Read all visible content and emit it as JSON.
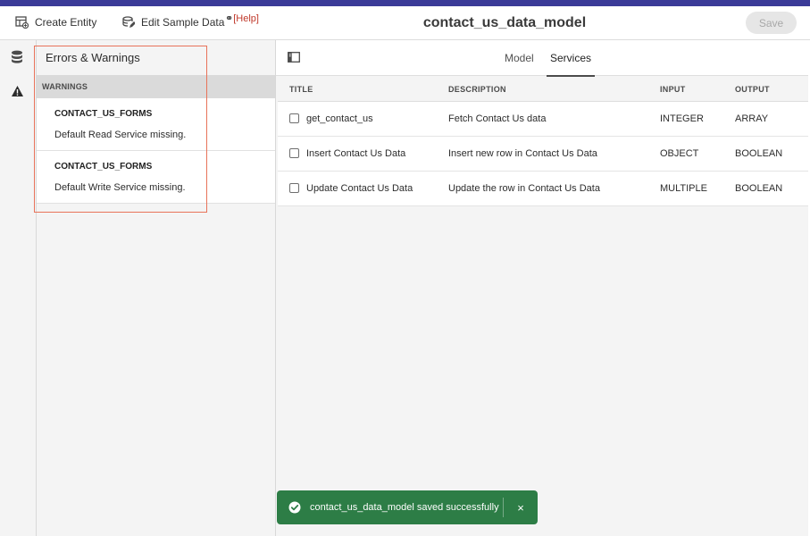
{
  "toolbar": {
    "create_entity": "Create Entity",
    "edit_sample_data": "Edit Sample Data",
    "help_link": "[Help]",
    "save": "Save"
  },
  "page_title": "contact_us_data_model",
  "errors_panel": {
    "title": "Errors & Warnings",
    "section": "WARNINGS",
    "items": [
      {
        "title": "CONTACT_US_FORMS",
        "message": "Default Read Service missing."
      },
      {
        "title": "CONTACT_US_FORMS",
        "message": "Default Write Service missing."
      }
    ]
  },
  "tabs": [
    {
      "label": "Model",
      "active": false
    },
    {
      "label": "Services",
      "active": true
    }
  ],
  "services_table": {
    "columns": [
      "TITLE",
      "DESCRIPTION",
      "INPUT",
      "OUTPUT"
    ],
    "rows": [
      {
        "title": "get_contact_us",
        "description": "Fetch Contact Us data",
        "input": "INTEGER",
        "output": "ARRAY"
      },
      {
        "title": "Insert Contact Us Data",
        "description": "Insert new row in Contact Us Data",
        "input": "OBJECT",
        "output": "BOOLEAN"
      },
      {
        "title": "Update Contact Us Data",
        "description": "Update the row in Contact Us Data",
        "input": "MULTIPLE",
        "output": "BOOLEAN"
      }
    ]
  },
  "toast": {
    "message": "contact_us_data_model saved successfully",
    "close": "×",
    "color": "#2d7d46"
  },
  "colors": {
    "accent_bar": "#3b3b98",
    "highlight": "#e8735a"
  },
  "icons": [
    "create-entity-icon",
    "edit-sample-data-icon",
    "link-icon",
    "database-icon",
    "warning-icon",
    "panel-toggle-icon",
    "checkmark-circle-icon",
    "close-icon"
  ]
}
